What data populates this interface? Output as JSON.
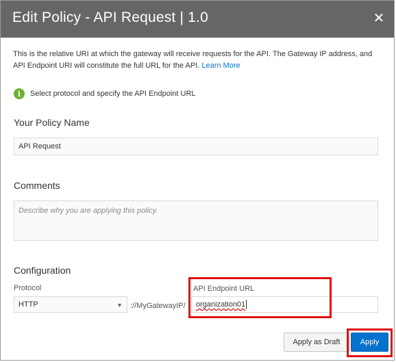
{
  "dialog": {
    "title": "Edit Policy - API Request | 1.0",
    "close_icon": "close-icon"
  },
  "description": {
    "text": "This is the relative URI at which the gateway will receive requests for the API. The Gateway IP address, and API Endpoint URI will constitute the full URL for the API.",
    "link": "Learn More"
  },
  "info": {
    "icon": "info-icon",
    "text": "Select protocol and specify the API Endpoint URL"
  },
  "policy_name": {
    "label": "Your Policy Name",
    "value": "API Request"
  },
  "comments": {
    "label": "Comments",
    "placeholder": "Describe why you are applying this policy."
  },
  "configuration": {
    "label": "Configuration",
    "protocol_label": "Protocol",
    "protocol_value": "HTTP",
    "gateway_prefix": "://MyGatewayIP/",
    "endpoint_label": "API Endpoint URL",
    "endpoint_value": "organization01"
  },
  "buttons": {
    "apply_draft": "Apply as Draft",
    "apply": "Apply"
  },
  "colors": {
    "titlebar": "#666666",
    "highlight": "#e01010",
    "primary": "#0572ce",
    "info_green": "#6cb035"
  }
}
